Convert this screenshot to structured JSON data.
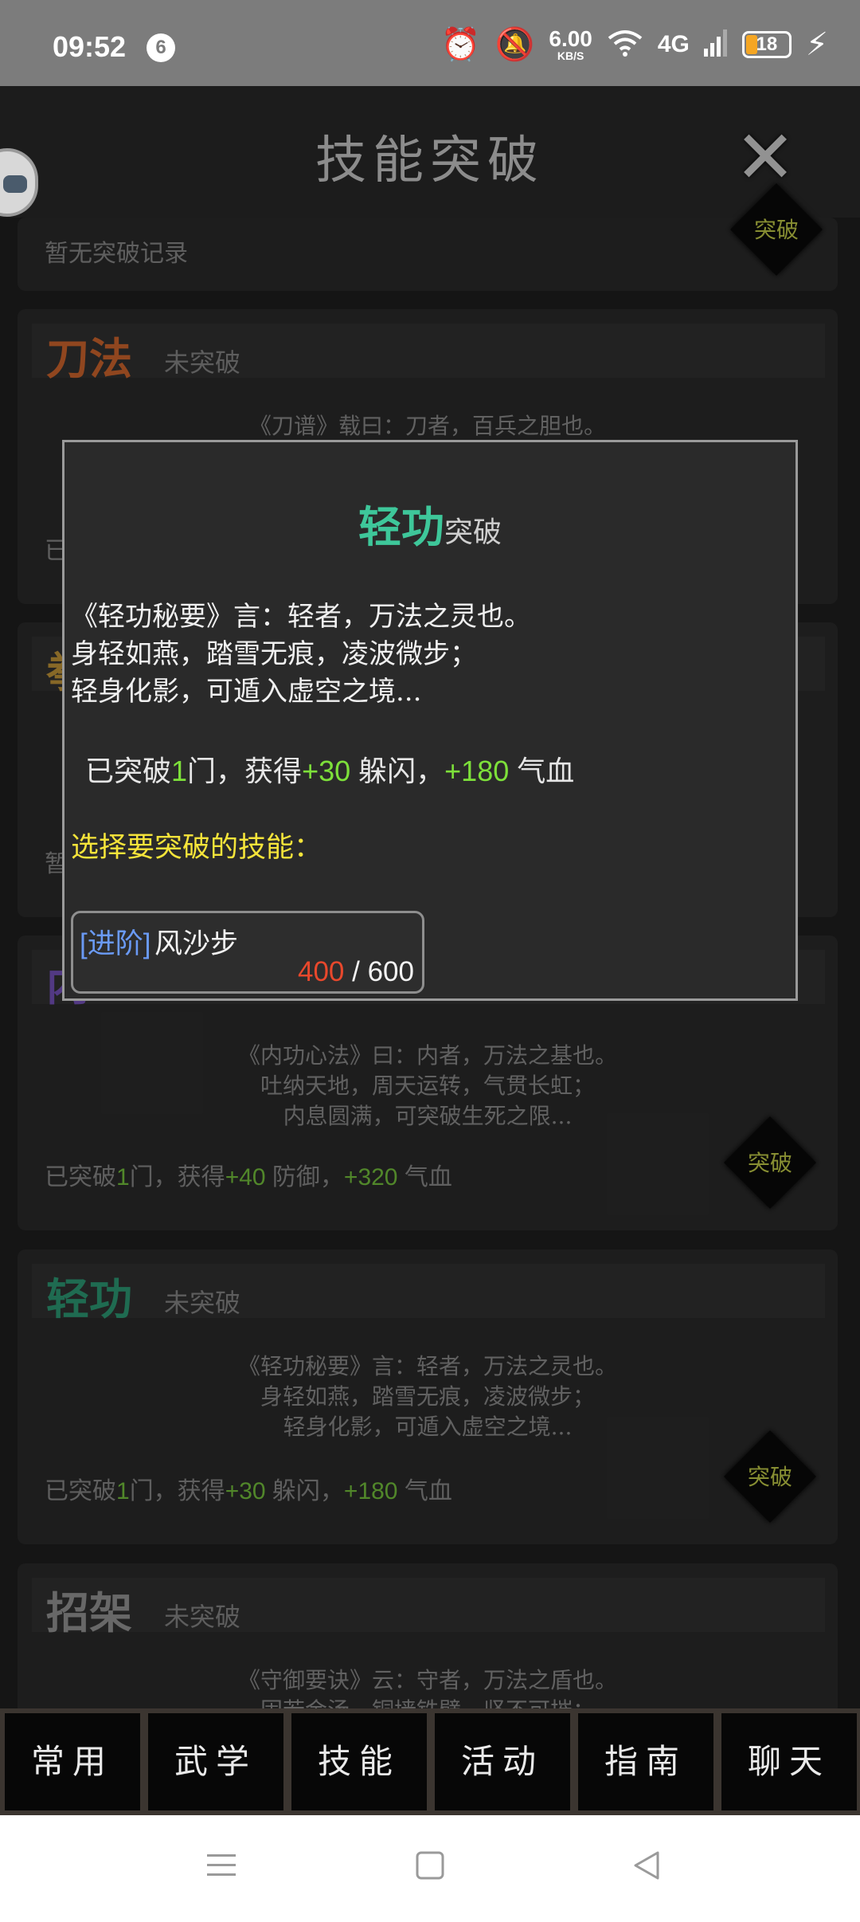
{
  "status_bar": {
    "time": "09:52",
    "notification_count": "6",
    "net_speed_value": "6.00",
    "net_speed_unit": "KB/S",
    "signal_label": "4G",
    "battery_level": "18"
  },
  "header": {
    "title": "技能突破",
    "close_label": "✕"
  },
  "cards": {
    "top": {
      "line": "暂无突破记录",
      "button": "突破"
    },
    "dao": {
      "name": "刀法",
      "status": "未突破",
      "desc": "《刀谱》载曰：刀者，百兵之胆也。",
      "line_prefix": "已"
    },
    "quan": {
      "name": "拳",
      "line_prefix": "暂"
    },
    "neigong": {
      "name": "内",
      "desc": "《内功心法》曰：内者，万法之基也。\n吐纳天地，周天运转，气贯长虹；\n内息圆满，可突破生死之限...",
      "line_a": "已突破",
      "count": "1",
      "line_b": "门，获得",
      "v1": "+40",
      "s1": " 防御，",
      "v2": "+320",
      "s2": " 气血",
      "button": "突破"
    },
    "qinggong": {
      "name": "轻功",
      "status": "未突破",
      "desc": "《轻功秘要》言：轻者，万法之灵也。\n身轻如燕，踏雪无痕，凌波微步；\n轻身化影，可遁入虚空之境...",
      "line_a": "已突破",
      "count": "1",
      "line_b": "门，获得",
      "v1": "+30",
      "s1": " 躲闪，",
      "v2": "+180",
      "s2": " 气血",
      "button": "突破"
    },
    "zhaojia": {
      "name": "招架",
      "status": "未突破",
      "desc": "《守御要诀》云：守者，万法之盾也。\n固若金汤，铜墙铁壁，坚不可摧；"
    }
  },
  "dialog": {
    "title_big": "轻功",
    "title_small": "突破",
    "verse": "《轻功秘要》言：轻者，万法之灵也。\n身轻如燕，踏雪无痕，凌波微步；\n轻身化影，可遁入虚空之境...",
    "gain_a": "已突破",
    "gain_count": "1",
    "gain_b": "门，获得",
    "gain_v1": "+30",
    "gain_s1": " 躲闪，",
    "gain_v2": "+180",
    "gain_s2": " 气血",
    "prompt": "选择要突破的技能：",
    "option": {
      "tag": "[进阶]",
      "name": "风沙步",
      "current": "400",
      "separator": " / ",
      "max": "600"
    }
  },
  "bottom_nav": [
    "常用",
    "武学",
    "技能",
    "活动",
    "指南",
    "聊天"
  ],
  "colors": {
    "accent_green": "#3ec79a",
    "gain_green": "#7de03a",
    "prompt_yellow": "#f5e43a",
    "tag_blue": "#6a9af5",
    "progress_red": "#e8482c",
    "dao_orange": "#d4682e"
  },
  "icons": {
    "status": [
      "alarm-icon",
      "mute-icon",
      "wifi-icon",
      "signal-icon",
      "battery-icon",
      "charging-icon"
    ],
    "system_nav": [
      "menu-icon",
      "home-icon",
      "back-icon"
    ]
  }
}
